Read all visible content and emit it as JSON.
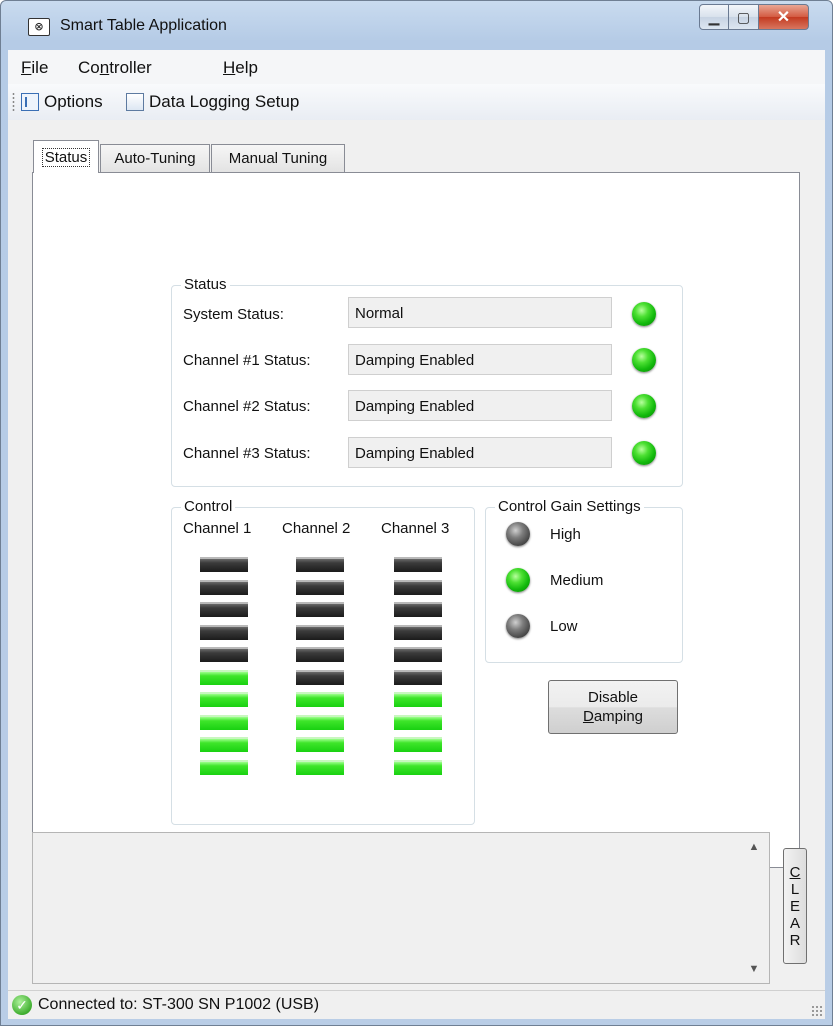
{
  "window": {
    "title": "Smart Table Application",
    "icon": "smart-table-app-icon",
    "controls": {
      "minimize": "minimize-icon",
      "maximize": "maximize-icon",
      "close": "close-icon"
    }
  },
  "menu": {
    "file": {
      "label": "File",
      "mnemonic": "F",
      "rest": "ile"
    },
    "controller": {
      "label": "Controller",
      "pre": "Co",
      "mnemonic": "n",
      "rest": "troller"
    },
    "help": {
      "label": "Help",
      "mnemonic": "H",
      "rest": "elp"
    }
  },
  "toolbar": {
    "options_label": "Options",
    "options_icon": "options-list-icon",
    "data_logging_label": "Data Logging Setup",
    "data_logging_icon": "data-logging-icon"
  },
  "tabs": [
    {
      "label": "Status",
      "active": true
    },
    {
      "label": "Auto-Tuning",
      "active": false
    },
    {
      "label": "Manual Tuning",
      "active": false
    }
  ],
  "status_group": {
    "title": "Status",
    "rows": [
      {
        "label": "System Status:",
        "value": "Normal",
        "led": "green"
      },
      {
        "label": "Channel #1 Status:",
        "value": "Damping Enabled",
        "led": "green"
      },
      {
        "label": "Channel #2 Status:",
        "value": "Damping Enabled",
        "led": "green"
      },
      {
        "label": "Channel #3 Status:",
        "value": "Damping Enabled",
        "led": "green"
      }
    ]
  },
  "control_group": {
    "title": "Control",
    "channels": [
      {
        "name": "Channel 1",
        "active_bars": 5,
        "total_bars": 10
      },
      {
        "name": "Channel 2",
        "active_bars": 4,
        "total_bars": 10
      },
      {
        "name": "Channel 3",
        "active_bars": 4,
        "total_bars": 10
      }
    ]
  },
  "gain_group": {
    "title": "Control Gain Settings",
    "options": [
      {
        "label": "High",
        "led": "gray"
      },
      {
        "label": "Medium",
        "led": "green"
      },
      {
        "label": "Low",
        "led": "gray"
      }
    ]
  },
  "disable_damping": {
    "line1": "Disable",
    "line2_mnemonic": "D",
    "line2_rest": "amping"
  },
  "log": {
    "text": ""
  },
  "clear_button": {
    "letters": [
      "C",
      "L",
      "E",
      "A",
      "R"
    ]
  },
  "statusbar": {
    "icon": "connected-check-icon",
    "text": "Connected  to:  ST-300 SN P1002 (USB)"
  },
  "colors": {
    "led_green": "#19d111",
    "led_gray": "#4a4a4a",
    "bar_on": "#3ee52a",
    "bar_off": "#1b1b1b"
  }
}
